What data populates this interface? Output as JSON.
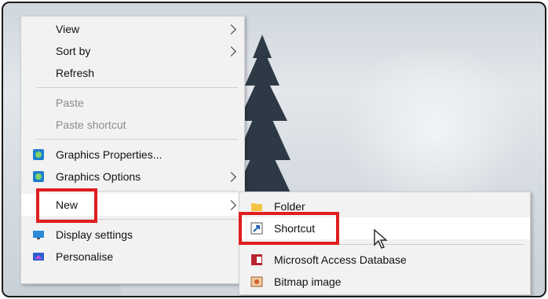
{
  "context_menu": {
    "items": [
      {
        "label": "View",
        "has_submenu": true
      },
      {
        "label": "Sort by",
        "has_submenu": true
      },
      {
        "label": "Refresh"
      },
      {
        "label": "Paste",
        "disabled": true
      },
      {
        "label": "Paste shortcut",
        "disabled": true
      },
      {
        "label": "Graphics Properties...",
        "icon": "intel-graphics-icon"
      },
      {
        "label": "Graphics Options",
        "icon": "intel-graphics-icon",
        "has_submenu": true
      },
      {
        "label": "New",
        "has_submenu": true,
        "highlighted": true
      },
      {
        "label": "Display settings",
        "icon": "display-icon"
      },
      {
        "label": "Personalise",
        "icon": "personalise-icon"
      }
    ]
  },
  "new_submenu": {
    "items": [
      {
        "label": "Folder",
        "icon": "folder-icon"
      },
      {
        "label": "Shortcut",
        "icon": "shortcut-icon",
        "highlighted": true
      },
      {
        "label": "Microsoft Access Database",
        "icon": "access-icon"
      },
      {
        "label": "Bitmap image",
        "icon": "bitmap-icon"
      }
    ]
  },
  "colors": {
    "menu_bg": "#f2f2f2",
    "highlight_box": "#e01e1e",
    "highlight_row": "#ffffff"
  }
}
